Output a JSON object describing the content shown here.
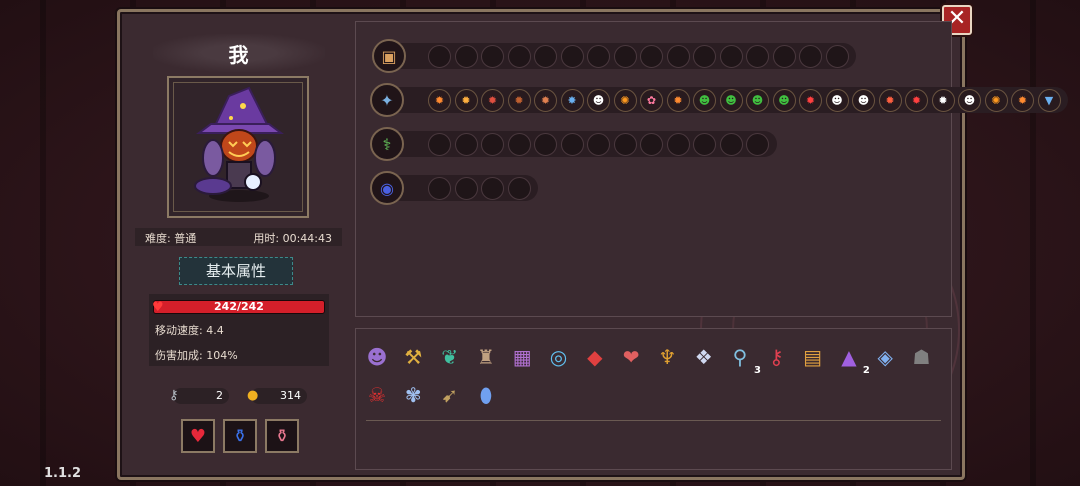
{
  "version": "1.1.2",
  "close_label": "✕",
  "player": {
    "name": "我",
    "difficulty_label": "难度: 普通",
    "time_label": "用时: 00:44:43"
  },
  "attributes": {
    "title": "基本属性",
    "hp_text": "242/242",
    "hp_fraction": 1.0,
    "move_speed": "移动速度: 4.4",
    "damage_bonus": "伤害加成: 104%"
  },
  "currency": {
    "keys": "2",
    "coins": "314"
  },
  "potions": [
    "red-potion",
    "blue-potion",
    "pink-potion"
  ],
  "rows": [
    {
      "icon": "chest-icon",
      "filled": [],
      "slots": 16
    },
    {
      "icon": "shuriken-icon",
      "filled": [
        "✹",
        "✹",
        "✹",
        "✹",
        "✹",
        "✸",
        "☻",
        "✺",
        "✿",
        "✹",
        "☻",
        "☻",
        "☻",
        "☻",
        "✹",
        "☻",
        "☻",
        "✹",
        "✹",
        "✹",
        "☻",
        "✺",
        "✹",
        "▼"
      ],
      "slots": 24
    },
    {
      "icon": "staff-icon",
      "filled": [],
      "slots": 13
    },
    {
      "icon": "orb-icon",
      "filled": [],
      "slots": 4
    }
  ],
  "items": [
    {
      "name": "hood-icon",
      "glyph": "☻",
      "count": ""
    },
    {
      "name": "pickaxe-icon",
      "glyph": "⚒",
      "count": ""
    },
    {
      "name": "leaf-icon",
      "glyph": "❦",
      "count": ""
    },
    {
      "name": "armor-icon",
      "glyph": "♜",
      "count": ""
    },
    {
      "name": "tome-icon",
      "glyph": "▦",
      "count": ""
    },
    {
      "name": "ring-icon",
      "glyph": "◎",
      "count": ""
    },
    {
      "name": "mask-icon",
      "glyph": "◆",
      "count": ""
    },
    {
      "name": "amulet-icon",
      "glyph": "❤",
      "count": ""
    },
    {
      "name": "chalice-icon",
      "glyph": "♆",
      "count": ""
    },
    {
      "name": "crystal-icon",
      "glyph": "❖",
      "count": ""
    },
    {
      "name": "magnifier-icon",
      "glyph": "⚲",
      "count": "3"
    },
    {
      "name": "key-icon",
      "glyph": "⚷",
      "count": ""
    },
    {
      "name": "scroll-icon",
      "glyph": "▤",
      "count": ""
    },
    {
      "name": "witch-hat-icon",
      "glyph": "▲",
      "count": "2"
    },
    {
      "name": "gem-icon",
      "glyph": "◈",
      "count": ""
    },
    {
      "name": "tombstone-icon",
      "glyph": "☗",
      "count": ""
    },
    {
      "name": "demon-icon",
      "glyph": "☠",
      "count": ""
    },
    {
      "name": "lotus-icon",
      "glyph": "✾",
      "count": ""
    },
    {
      "name": "arrow-icon",
      "glyph": "➹",
      "count": ""
    },
    {
      "name": "egg-icon",
      "glyph": "⬮",
      "count": ""
    }
  ],
  "colors": {
    "accent": "#d41f2a",
    "frame": "#8a7660",
    "panel": "#3a2a30"
  }
}
